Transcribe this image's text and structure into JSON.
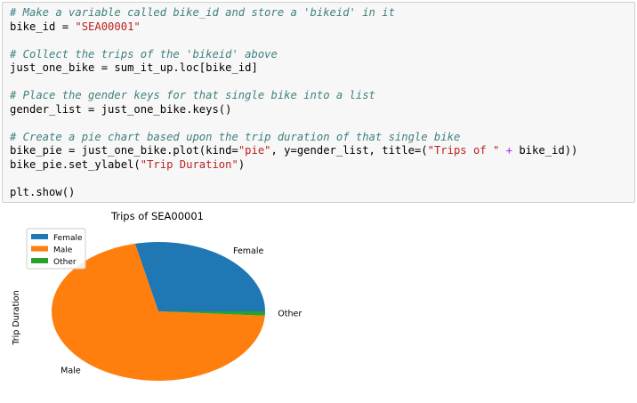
{
  "code": {
    "lines": [
      {
        "type": "comment",
        "text": "# Make a variable called bike_id and store a 'bikeid' in it"
      },
      {
        "type": "code",
        "parts": [
          "bike_id = ",
          "\"SEA00001\"",
          ""
        ]
      },
      {
        "type": "blank"
      },
      {
        "type": "comment",
        "text": "# Collect the trips of the 'bikeid' above"
      },
      {
        "type": "code",
        "parts": [
          "just_one_bike = sum_it_up.loc[bike_id]",
          "",
          ""
        ]
      },
      {
        "type": "blank"
      },
      {
        "type": "comment",
        "text": "# Place the gender keys for that single bike into a list"
      },
      {
        "type": "code",
        "parts": [
          "gender_list = just_one_bike.keys()",
          "",
          ""
        ]
      },
      {
        "type": "blank"
      },
      {
        "type": "comment",
        "text": "# Create a pie chart based upon the trip duration of that single bike"
      },
      {
        "type": "code5",
        "parts": [
          "bike_pie = just_one_bike.plot(kind=",
          "\"pie\"",
          ", y=gender_list, title=(",
          "\"Trips of \"",
          " + ",
          "bike_id))"
        ]
      },
      {
        "type": "code",
        "parts": [
          "bike_pie.set_ylabel(",
          "\"Trip Duration\"",
          ")"
        ]
      },
      {
        "type": "blank"
      },
      {
        "type": "code",
        "parts": [
          "plt.show()",
          "",
          ""
        ]
      }
    ]
  },
  "chart_data": {
    "type": "pie",
    "title": "Trips of SEA00001",
    "ylabel": "Trip Duration",
    "categories": [
      "Female",
      "Male",
      "Other"
    ],
    "values": [
      28.5,
      70.5,
      1.0
    ],
    "colors": [
      "#1f77b4",
      "#ff7f0e",
      "#2ca02c"
    ],
    "legend": {
      "placement": "upper-left",
      "entries": [
        "Female",
        "Male",
        "Other"
      ]
    },
    "slice_labels": [
      "Female",
      "Male",
      "Other"
    ]
  }
}
